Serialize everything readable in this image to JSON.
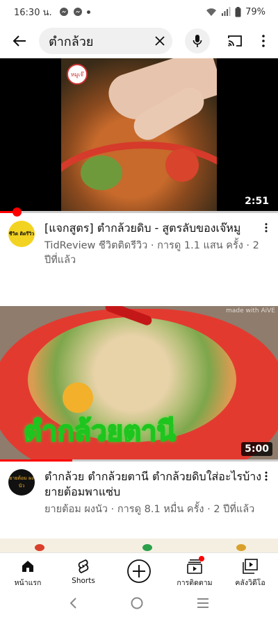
{
  "status": {
    "time": "16:30 น.",
    "battery": "79%"
  },
  "search": {
    "query": "ตำกล้วย"
  },
  "videos": [
    {
      "title": "[แจกสูตร] ตำกล้วยดิบ - สูตรลับของเจ๊หมู",
      "subtitle": "TidReview ชีวิตติดรีวิว · การดู 1.1 แสน ครั้ง · 2 ปีที่แล้ว",
      "duration": "2:51",
      "avatar_text": "ชีวิต ติดรีวิว",
      "logo_text": "หมูเจ๊",
      "progress": 0.06
    },
    {
      "title": "ตำกล้วย ตำกล้วยตานี ตำกล้วยดิบใส่อะไรบ้าง ยายต้อมพาแซ่บ",
      "subtitle": "ยายต้อม ผงนัว · การดู 8.1 หมื่น ครั้ง · 2 ปีที่แล้ว",
      "duration": "5:00",
      "caption": "ตำกล้วยตานี",
      "avatar_text": "ยายต้อม ผงนัว",
      "tag": "made with AiVE",
      "progress": 0.26
    }
  ],
  "nav": {
    "home": "หน้าแรก",
    "shorts": "Shorts",
    "subscriptions": "การติดตาม",
    "library": "คลังวิดีโอ"
  },
  "colors": {
    "brand_red": "#ff0000",
    "text_primary": "#0f0f0f",
    "text_secondary": "#606060"
  }
}
